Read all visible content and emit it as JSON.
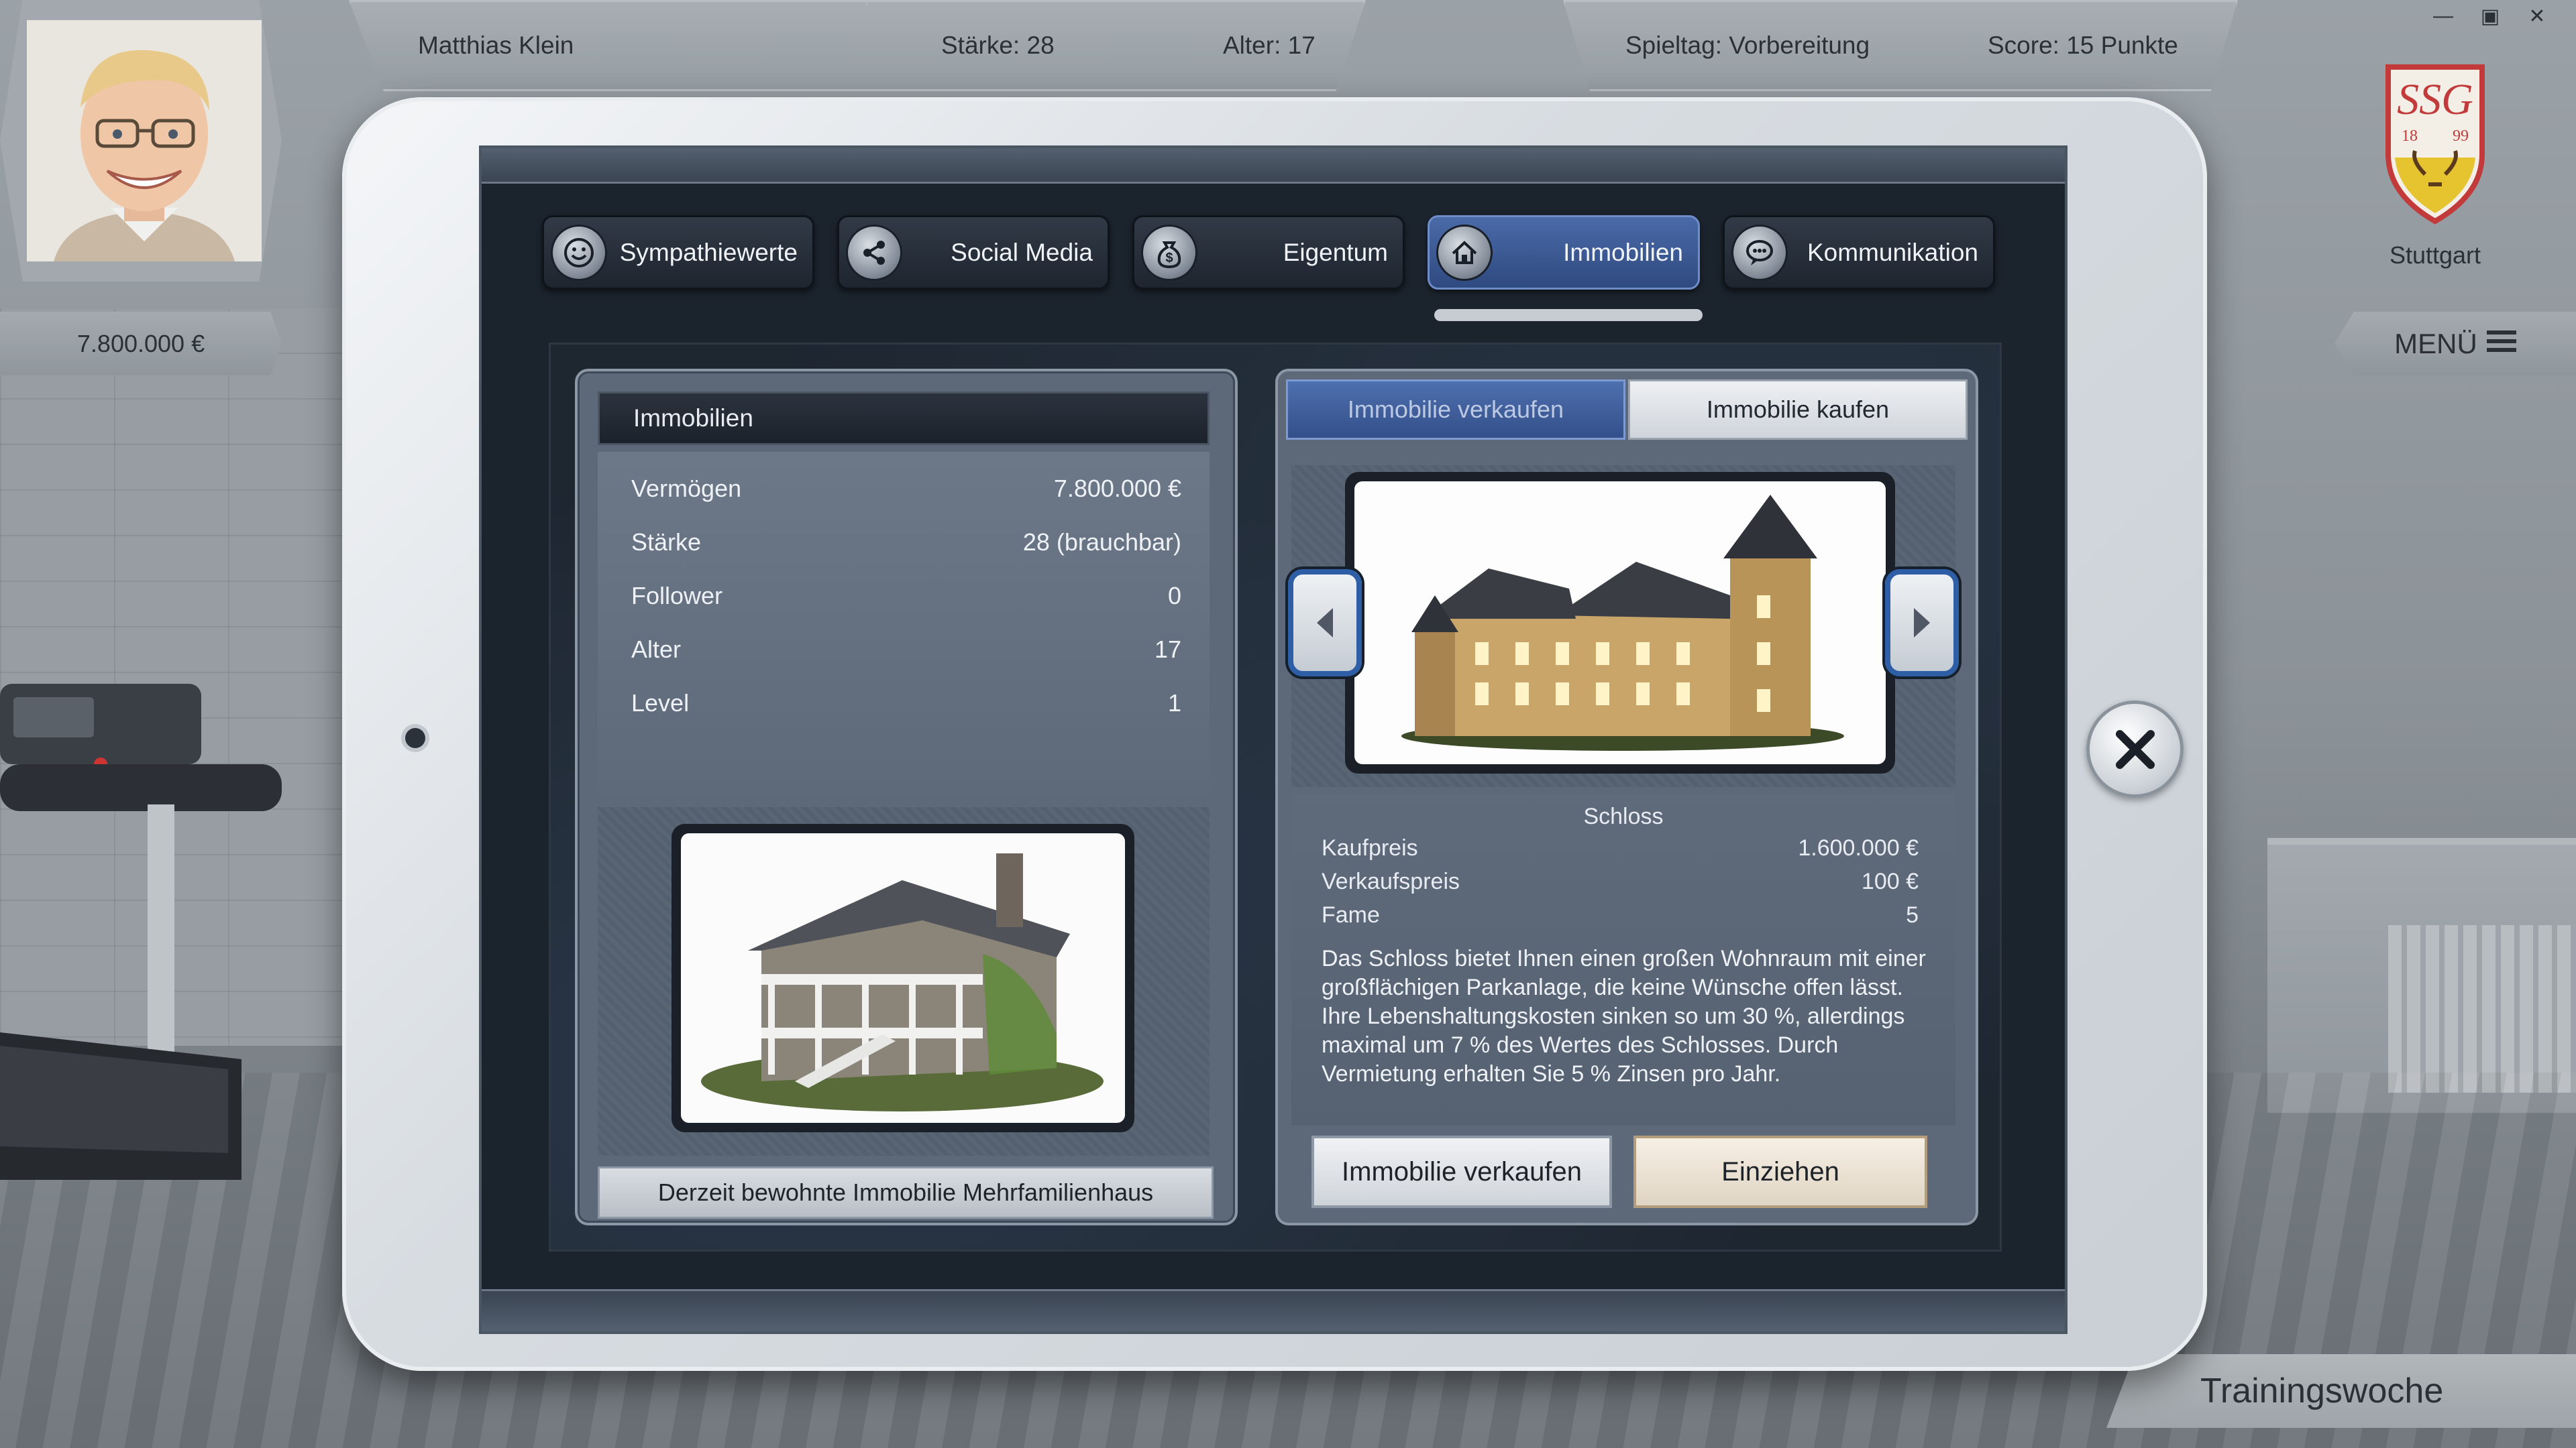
{
  "player": {
    "name": "Matthias Klein",
    "strength": "Stärke: 28",
    "age": "Alter: 17",
    "money": "7.800.000 €"
  },
  "game": {
    "matchday": "Spieltag: Vorbereitung",
    "score": "Score: 15 Punkte",
    "club_name": "Stuttgart",
    "club_logo_text": "SSG",
    "club_year_left": "18",
    "club_year_right": "99",
    "menu_label": "MENÜ",
    "week_label": "Trainingswoche"
  },
  "tabs": [
    {
      "label": "Sympathiewerte",
      "icon": "smiley-icon"
    },
    {
      "label": "Social Media",
      "icon": "share-icon"
    },
    {
      "label": "Eigentum",
      "icon": "money-bag-icon"
    },
    {
      "label": "Immobilien",
      "icon": "house-icon",
      "active": true
    },
    {
      "label": "Kommunikation",
      "icon": "speech-bubble-icon"
    }
  ],
  "left_panel": {
    "title": "Immobilien",
    "stats": [
      {
        "label": "Vermögen",
        "value": "7.800.000 €"
      },
      {
        "label": "Stärke",
        "value": "28 (brauchbar)"
      },
      {
        "label": "Follower",
        "value": "0"
      },
      {
        "label": "Alter",
        "value": "17"
      },
      {
        "label": "Level",
        "value": "1"
      }
    ],
    "current_property": "Derzeit bewohnte Immobilie Mehrfamilienhaus"
  },
  "right_panel": {
    "tab_sell": "Immobilie verkaufen",
    "tab_buy": "Immobilie kaufen",
    "property_name": "Schloss",
    "rows": [
      {
        "label": "Kaufpreis",
        "value": "1.600.000 €"
      },
      {
        "label": "Verkaufspreis",
        "value": "100 €"
      },
      {
        "label": "Fame",
        "value": "5"
      }
    ],
    "description": "Das Schloss bietet Ihnen einen großen Wohnraum mit einer großflächigen Parkanlage, die keine Wünsche offen lässt. Ihre Lebenshaltungskosten sinken so um 30 %, allerdings maximal um 7 % des Wertes des Schlosses. Durch Vermietung erhalten Sie 5 % Zinsen pro Jahr.",
    "btn_sell": "Immobilie verkaufen",
    "btn_move": "Einziehen"
  },
  "colors": {
    "accent_blue": "#2d5ea6",
    "active_tab": "#3f5f9c",
    "panel": "#5d6979"
  }
}
